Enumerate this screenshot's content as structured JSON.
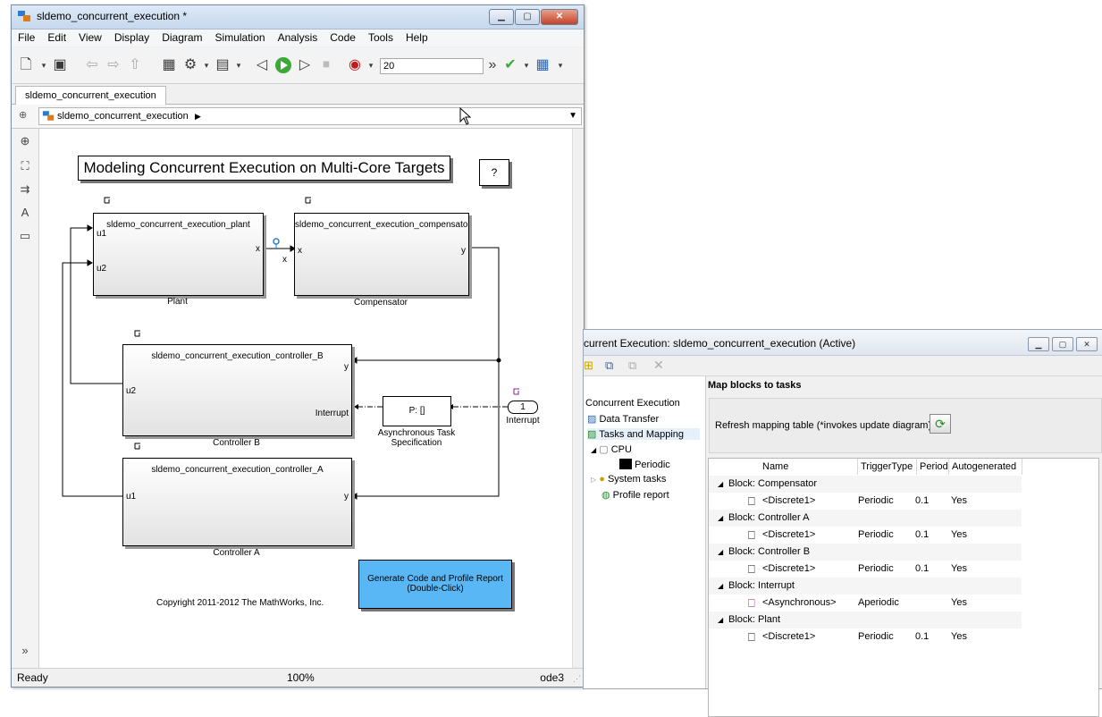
{
  "sim_window": {
    "title": "sldemo_concurrent_execution *",
    "menu": [
      "File",
      "Edit",
      "View",
      "Display",
      "Diagram",
      "Simulation",
      "Analysis",
      "Code",
      "Tools",
      "Help"
    ],
    "stop_time": "20",
    "tab": "sldemo_concurrent_execution",
    "breadcrumb": "sldemo_concurrent_execution",
    "status_left": "Ready",
    "status_zoom": "100%",
    "status_solver": "ode3"
  },
  "model": {
    "banner_title": "Modeling Concurrent Execution on Multi-Core Targets",
    "help_button": "?",
    "plant": {
      "name": "sldemo_concurrent_execution_plant",
      "label": "Plant",
      "in1": "u1",
      "in2": "u2",
      "out": "x"
    },
    "compensator": {
      "name": "sldemo_concurrent_execution_compensator",
      "label": "Compensator",
      "in": "x",
      "out": "y"
    },
    "signal_x": "x",
    "controller_b": {
      "name": "sldemo_concurrent_execution_controller_B",
      "label": "Controller B",
      "out": "y",
      "in_u2": "u2",
      "interrupt": "Interrupt"
    },
    "controller_a": {
      "name": "sldemo_concurrent_execution_controller_A",
      "label": "Controller A",
      "in": "u1",
      "out": "y"
    },
    "task_spec": {
      "value": "P: []",
      "label_line1": "Asynchronous Task",
      "label_line2": "Specification"
    },
    "interrupt_port": {
      "number": "1",
      "label": "Interrupt"
    },
    "generate_button_line1": "Generate Code and Profile Report",
    "generate_button_line2": "(Double-Click)",
    "copyright": "Copyright 2011-2012 The MathWorks, Inc."
  },
  "ce_window": {
    "title": "current Execution: sldemo_concurrent_execution (Active)",
    "tree": {
      "root": "Concurrent Execution",
      "data_transfer": "Data Transfer",
      "tasks_and_mapping": "Tasks and Mapping",
      "cpu": "CPU",
      "periodic": "Periodic",
      "system_tasks": "System tasks",
      "profile_report": "Profile report"
    },
    "panel_title": "Map blocks to tasks",
    "refresh_label": "Refresh mapping table (*invokes update diagram)",
    "columns": [
      "Name",
      "TriggerType",
      "Period",
      "Autogenerated"
    ],
    "rows": [
      {
        "group": "Block: Compensator",
        "name": "<Discrete1>",
        "trigger": "Periodic",
        "period": "0.1",
        "auto": "Yes"
      },
      {
        "group": "Block: Controller A",
        "name": "<Discrete1>",
        "trigger": "Periodic",
        "period": "0.1",
        "auto": "Yes"
      },
      {
        "group": "Block: Controller B",
        "name": "<Discrete1>",
        "trigger": "Periodic",
        "period": "0.1",
        "auto": "Yes"
      },
      {
        "group": "Block: Interrupt",
        "name": "<Asynchronous>",
        "trigger": "Aperiodic",
        "period": "",
        "auto": "Yes"
      },
      {
        "group": "Block: Plant",
        "name": "<Discrete1>",
        "trigger": "Periodic",
        "period": "0.1",
        "auto": "Yes"
      }
    ]
  },
  "colors": {
    "generate_button": "#59b7f5",
    "titlebar": "#c6d8ee",
    "async_icon": "#8b1f8b"
  }
}
